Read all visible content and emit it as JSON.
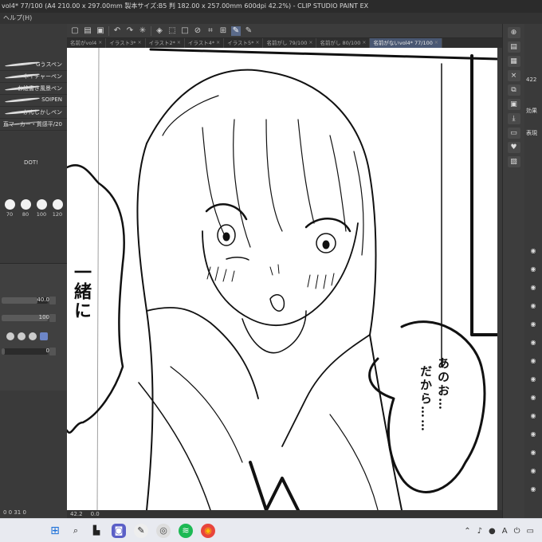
{
  "window": {
    "title": "vol4* 77/100 (A4 210.00 x 297.00mm 製本サイズ:B5 判 182.00 x 257.00mm 600dpi 42.2%) - CLIP STUDIO PAINT EX",
    "menu_help": "ヘルプ(H)"
  },
  "tabs": [
    {
      "label": "名前がvol4",
      "active": false
    },
    {
      "label": "イラスト3*",
      "active": false
    },
    {
      "label": "イラスト2*",
      "active": false
    },
    {
      "label": "イラスト4*",
      "active": false
    },
    {
      "label": "イラスト5*",
      "active": false
    },
    {
      "label": "名前がし 79/100",
      "active": false
    },
    {
      "label": "名前がし 80/100",
      "active": false
    },
    {
      "label": "名前がないvol4* 77/100",
      "active": true
    }
  ],
  "brushes": [
    {
      "name": "Gうスペン"
    },
    {
      "name": "ネイチャーペン"
    },
    {
      "name": "お絵書き風景ペン"
    },
    {
      "name": "SOIPEN"
    },
    {
      "name": "かんじかしペン"
    },
    {
      "name": "直マーカー・質感平/20"
    }
  ],
  "brush_dot_label": "DOT!",
  "brush_sizes": [
    "70",
    "80",
    "100",
    "120"
  ],
  "tool_property": {
    "size_value": "40.0",
    "opacity_value": "100",
    "third_value": "0"
  },
  "status": {
    "zoom": "42.2",
    "rotation": "0.0",
    "left_status": "0  0  31  0"
  },
  "right_panel": {
    "zoom_value": "422",
    "effect_label": "効果",
    "display_label": "表現"
  },
  "canvas_text": {
    "bubble_left_line1": "一緒に",
    "bubble_right_line1": "あのお…",
    "bubble_right_line2": "だから……"
  },
  "taskbar": {
    "apps": [
      "start-icon",
      "search-icon",
      "taskview-icon",
      "chat-icon",
      "clipstudio-icon",
      "clipstudio2-icon",
      "spotify-icon",
      "chrome-icon"
    ]
  }
}
